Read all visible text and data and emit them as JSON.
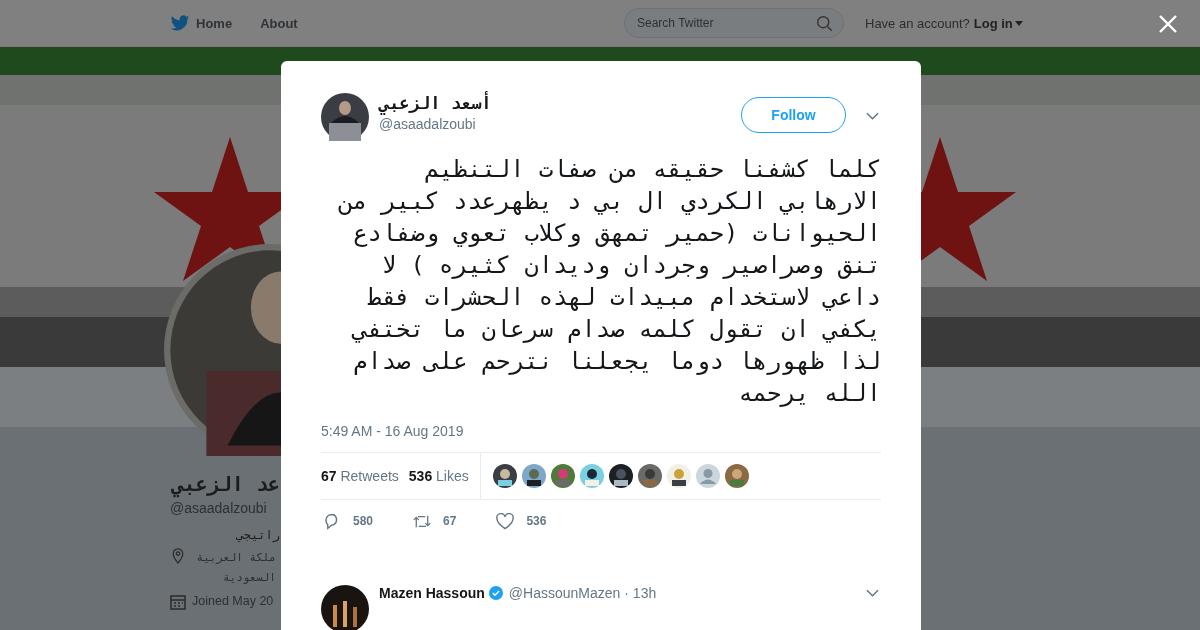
{
  "header": {
    "home_link": "Home",
    "about_link": "About",
    "search": {
      "placeholder": "Search Twitter"
    },
    "account_prompt": "Have an account?",
    "login": "Log in"
  },
  "profile": {
    "name": "عد الزعبي",
    "handle": "@asaadalzoubi",
    "bio": "راتيجي",
    "location": "ملكة العربية السعودية",
    "joined": "Joined May 20"
  },
  "tweet": {
    "name": "أسعد الزعبي",
    "handle": "@asaadalzoubi",
    "follow": "Follow",
    "text": "كلما كشفنا حقيقه من صفات التنظيم الارهابي الكردي ال بي د يظهرعدد كبير من الحيوانات (حمير تمهق وكلاب تعوي وضفادع تنق وصراصير وجردان وديدان كثيره ) لا داعي لاستخدام مبيدات لهذه الحشرات فقط يكفي ان تقول كلمه صدام سرعان ما تختفي لذا ظهورها دوما يجعلنا نترحم على صدام\nالله يرحمه",
    "time": "5:49 AM - 16 Aug 2019",
    "retweets": {
      "count": "67",
      "label": "Retweets"
    },
    "likes": {
      "count": "536",
      "label": "Likes"
    },
    "likers": [
      {
        "kind": "picture"
      },
      {
        "kind": "picture"
      },
      {
        "kind": "picture"
      },
      {
        "kind": "picture"
      },
      {
        "kind": "picture"
      },
      {
        "kind": "picture"
      },
      {
        "kind": "picture"
      },
      {
        "kind": "default"
      },
      {
        "kind": "picture"
      }
    ],
    "reply_count": "580",
    "retweet_count": "67",
    "like_count": "536"
  },
  "reply": {
    "name": "Mazen Hassoun",
    "verified": true,
    "handle": "@HassounMazen",
    "time": "· 13h"
  }
}
